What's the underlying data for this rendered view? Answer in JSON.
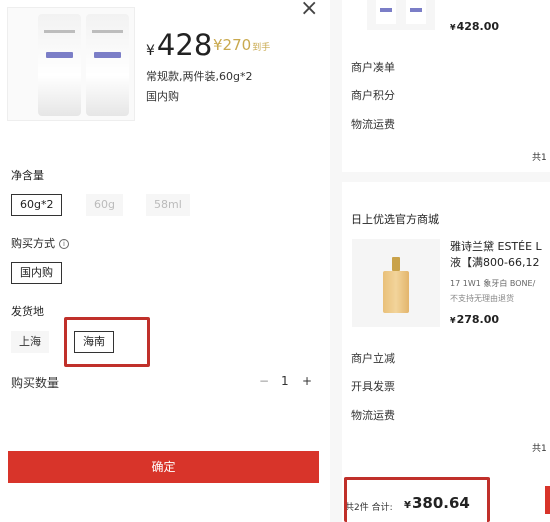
{
  "left_panel": {
    "close_icon": "×",
    "price": {
      "symbol": "¥",
      "value": "428"
    },
    "secondary_price": {
      "value": "¥270",
      "tag": "到手"
    },
    "spec": "常规款,两件装,60g*2",
    "region": "国内购",
    "net_content": {
      "label": "净含量",
      "options": [
        "60g*2",
        "60g",
        "58ml"
      ]
    },
    "purchase_method": {
      "label": "购买方式",
      "info_icon": "i",
      "option": "国内购"
    },
    "ship_from": {
      "label": "发货地",
      "options": [
        "上海",
        "海南"
      ]
    },
    "quantity": {
      "label": "购买数量",
      "minus": "−",
      "value": "1",
      "plus": "+"
    },
    "confirm_label": "确定"
  },
  "right_panel": {
    "top_price": {
      "symbol": "¥",
      "value": "428.00"
    },
    "rows_top": [
      "商户凑单",
      "商户积分",
      "物流运费"
    ],
    "total_top": "共1",
    "store_name": "日上优选官方商城",
    "product": {
      "title_line1": "雅诗兰黛 ESTÉE L",
      "title_line2": "液【满800-66,12",
      "variant": "17 1W1 象牙白 BONE/",
      "note": "不支持无理由退货",
      "price": {
        "symbol": "¥",
        "value": "278.00"
      }
    },
    "rows_bottom": [
      "商户立减",
      "开具发票",
      "物流运费"
    ],
    "total_bottom": "共1",
    "summary": {
      "count": "共2件",
      "label": "合计:",
      "symbol": "¥",
      "value": "380.64"
    }
  },
  "colors": {
    "accent_red": "#d8342a",
    "highlight_border": "#c0302a",
    "gold": "#c9a94e"
  }
}
